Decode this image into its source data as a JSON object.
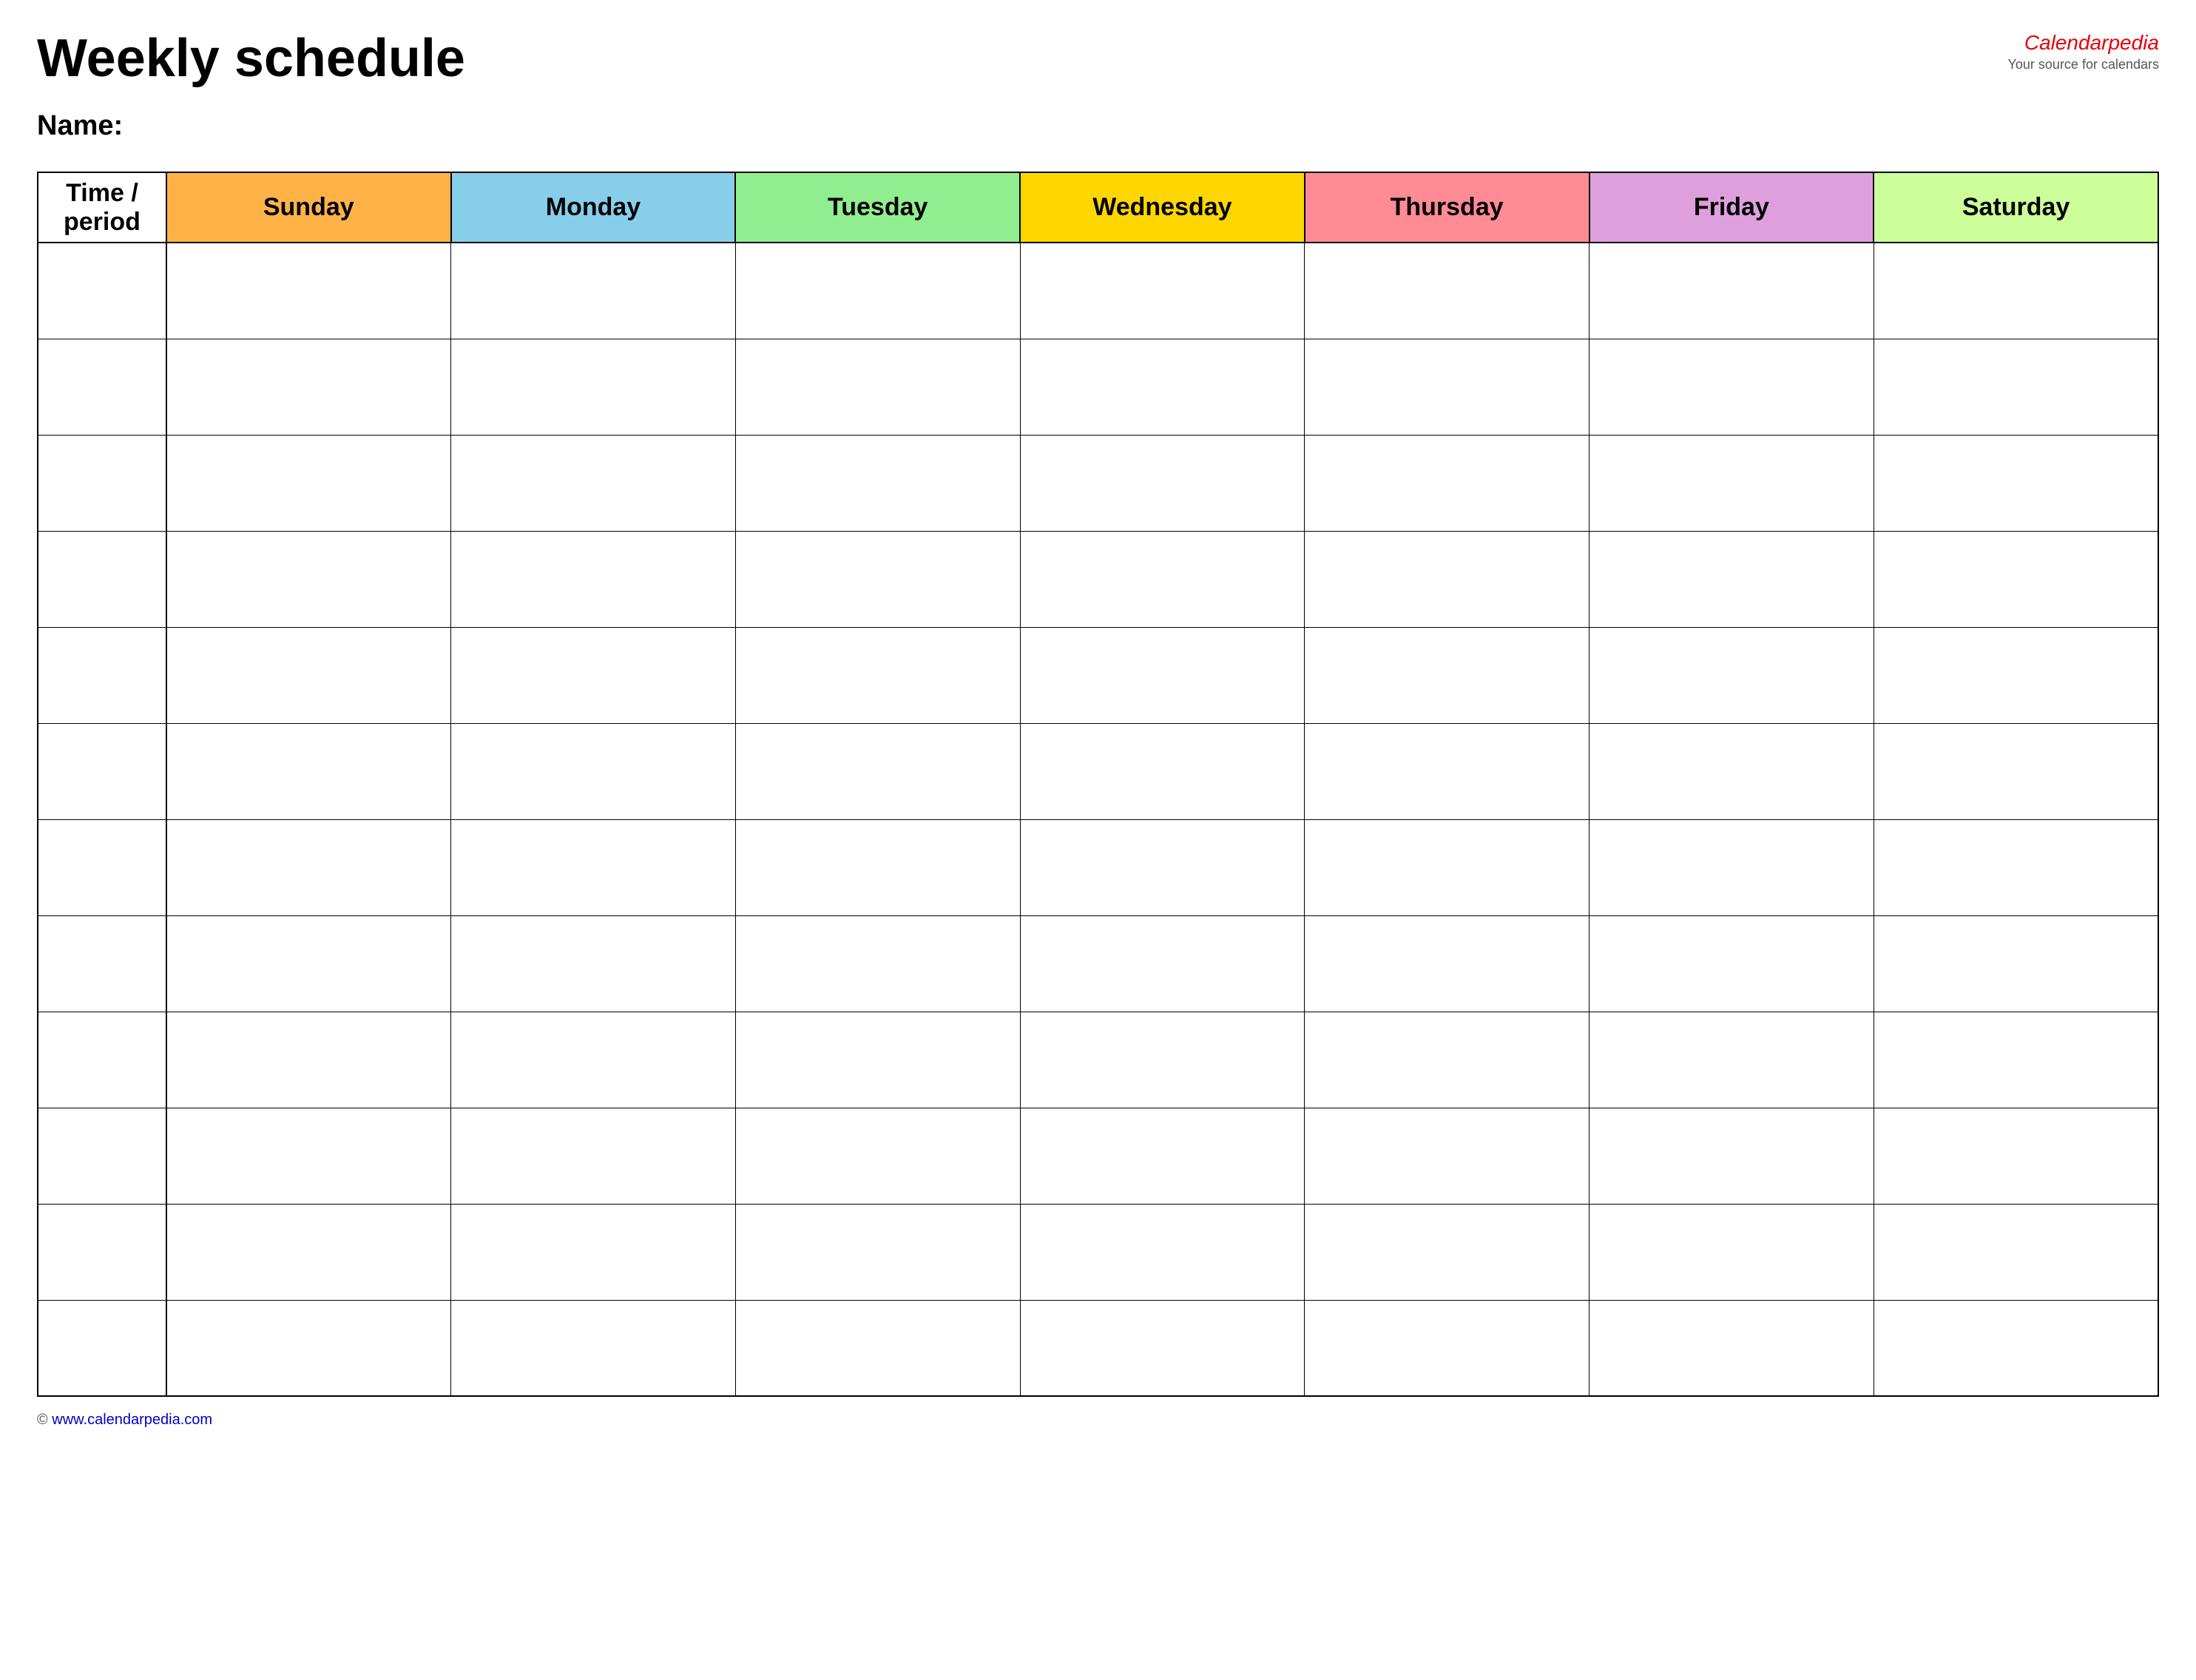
{
  "header": {
    "title": "Weekly schedule",
    "brand": {
      "name_plain": "Calendar",
      "name_colored": "pedia",
      "tagline": "Your source for calendars"
    }
  },
  "name_label": "Name:",
  "table": {
    "columns": [
      {
        "id": "time",
        "label": "Time / period",
        "color": "#ffffff"
      },
      {
        "id": "sunday",
        "label": "Sunday",
        "color": "#ffb347"
      },
      {
        "id": "monday",
        "label": "Monday",
        "color": "#87ceeb"
      },
      {
        "id": "tuesday",
        "label": "Tuesday",
        "color": "#90ee90"
      },
      {
        "id": "wednesday",
        "label": "Wednesday",
        "color": "#ffd700"
      },
      {
        "id": "thursday",
        "label": "Thursday",
        "color": "#ff8c94"
      },
      {
        "id": "friday",
        "label": "Friday",
        "color": "#dda0dd"
      },
      {
        "id": "saturday",
        "label": "Saturday",
        "color": "#ccff99"
      }
    ],
    "row_count": 12
  },
  "footer": {
    "url": "www.calendarpedia.com"
  }
}
